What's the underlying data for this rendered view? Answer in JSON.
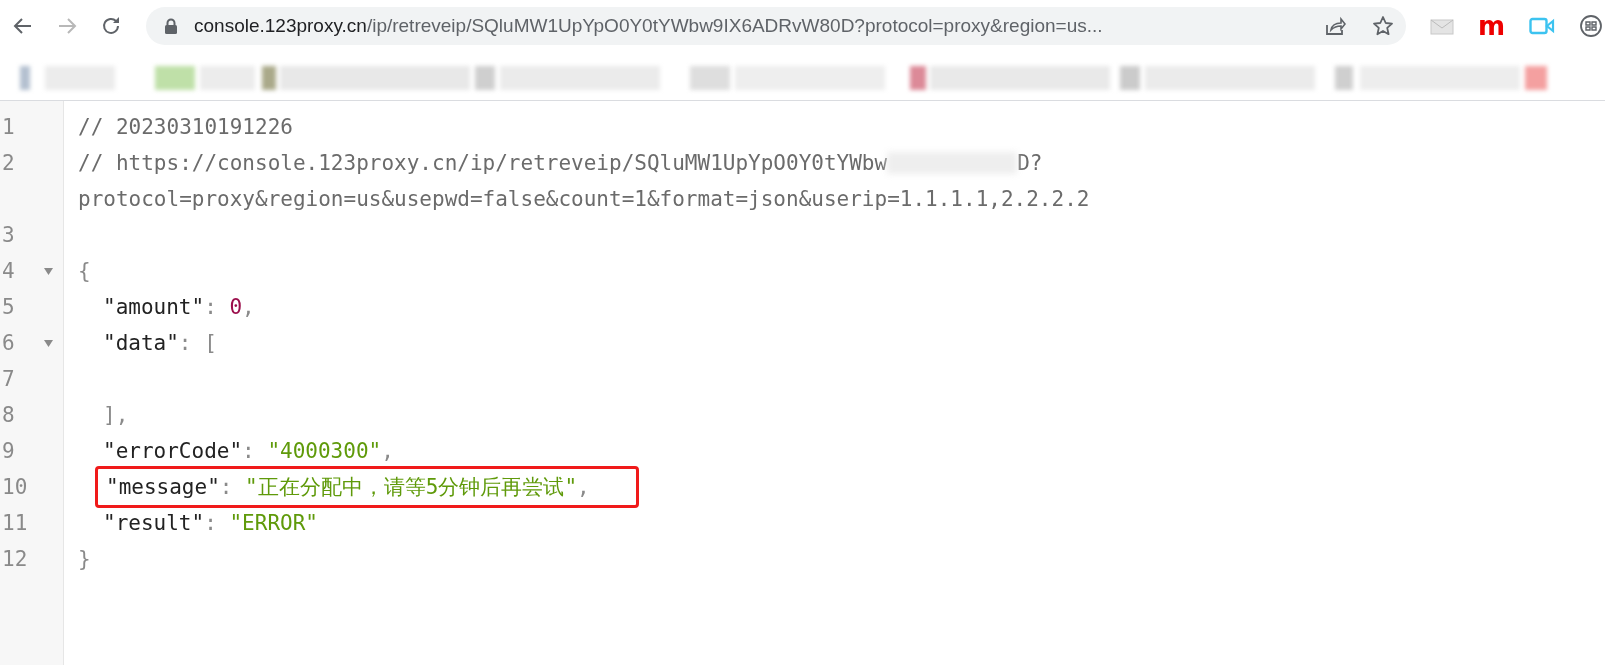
{
  "browser": {
    "address": {
      "host": "console.123proxy.cn",
      "path": "/ip/retreveip/SQluMW1UpYpO0Y0tYWbw9IX6ADRvW80D?protocol=proxy&region=us..."
    },
    "extensions": [
      {
        "kind": "mail"
      },
      {
        "kind": "letter",
        "label": "m"
      },
      {
        "kind": "camera"
      },
      {
        "kind": "circle"
      }
    ]
  },
  "code": {
    "lines": [
      {
        "number": "1",
        "tokens": [
          {
            "kind": "comment",
            "text": "// 20230310191226"
          }
        ]
      },
      {
        "number": "2",
        "tokens": [
          {
            "kind": "comment",
            "text": "// https://console.123proxy.cn/ip/retreveip/SQluMW1UpYpO0Y0tYWbw"
          },
          {
            "kind": "redacted"
          },
          {
            "kind": "comment",
            "text": "D?"
          },
          {
            "kind": "break"
          },
          {
            "kind": "comment",
            "text": "protocol=proxy&region=us&usepwd=false&count=1&format=json&userip=1.1.1.1,2.2.2.2"
          }
        ]
      },
      {
        "number": "3"
      },
      {
        "number": "4",
        "fold": {
          "expanded": true
        },
        "tokens": [
          {
            "kind": "punct",
            "text": "{"
          }
        ]
      },
      {
        "number": "5",
        "tokens": [
          {
            "kind": "indent"
          },
          {
            "kind": "key",
            "text": "\"amount\""
          },
          {
            "kind": "punct",
            "text": ": "
          },
          {
            "kind": "number",
            "text": "0"
          },
          {
            "kind": "punct",
            "text": ","
          }
        ]
      },
      {
        "number": "6",
        "fold": {
          "expanded": true
        },
        "tokens": [
          {
            "kind": "indent"
          },
          {
            "kind": "key",
            "text": "\"data\""
          },
          {
            "kind": "punct",
            "text": ": ["
          }
        ]
      },
      {
        "number": "7"
      },
      {
        "number": "8",
        "tokens": [
          {
            "kind": "indent"
          },
          {
            "kind": "punct",
            "text": "],"
          }
        ]
      },
      {
        "number": "9",
        "tokens": [
          {
            "kind": "indent"
          },
          {
            "kind": "key",
            "text": "\"errorCode\""
          },
          {
            "kind": "punct",
            "text": ": "
          },
          {
            "kind": "string",
            "text": "\"4000300\""
          },
          {
            "kind": "punct",
            "text": ","
          }
        ]
      },
      {
        "number": "10",
        "highlighted": true,
        "tokens": [
          {
            "kind": "indent"
          },
          {
            "kind": "key",
            "text": "\"message\""
          },
          {
            "kind": "punct",
            "text": ": "
          },
          {
            "kind": "string",
            "text": "\"正在分配中，请等5分钟后再尝试\""
          },
          {
            "kind": "punct",
            "text": ","
          }
        ]
      },
      {
        "number": "11",
        "tokens": [
          {
            "kind": "indent"
          },
          {
            "kind": "key",
            "text": "\"result\""
          },
          {
            "kind": "punct",
            "text": ": "
          },
          {
            "kind": "string",
            "text": "\"ERROR\""
          }
        ]
      },
      {
        "number": "12",
        "tokens": [
          {
            "kind": "punct",
            "text": "}"
          }
        ]
      }
    ]
  }
}
